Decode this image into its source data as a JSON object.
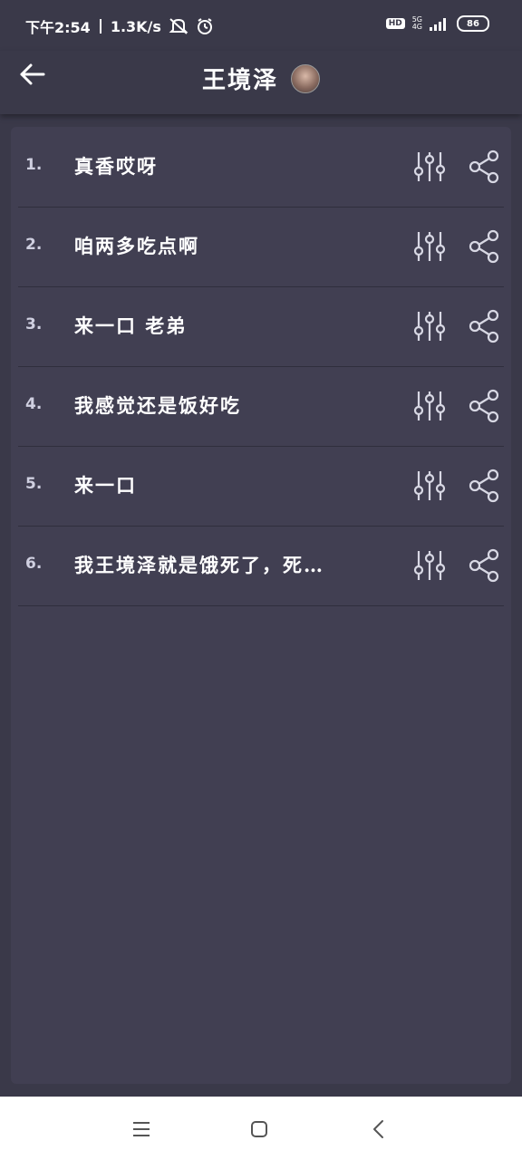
{
  "status": {
    "time": "下午2:54",
    "speed": "1.3K/s",
    "hd": "HD",
    "net_top": "5G",
    "net_bottom": "4G",
    "battery": "86"
  },
  "header": {
    "title": "王境泽"
  },
  "rows": [
    {
      "index": "1.",
      "title": "真香哎呀"
    },
    {
      "index": "2.",
      "title": "咱两多吃点啊"
    },
    {
      "index": "3.",
      "title": "来一口 老弟"
    },
    {
      "index": "4.",
      "title": "我感觉还是饭好吃"
    },
    {
      "index": "5.",
      "title": "来一口"
    },
    {
      "index": "6.",
      "title": " 我王境泽就是饿死了，死…"
    }
  ],
  "colors": {
    "background": "#3a3949",
    "card": "#413f52",
    "icon": "#d8d8e4",
    "nav_icon": "#555555"
  },
  "icons": {
    "back": "arrow-left-icon",
    "sliders": "sliders-icon",
    "share": "share-icon",
    "menu": "menu-icon",
    "home": "square-home-icon",
    "nav_back": "chevron-left-icon"
  }
}
